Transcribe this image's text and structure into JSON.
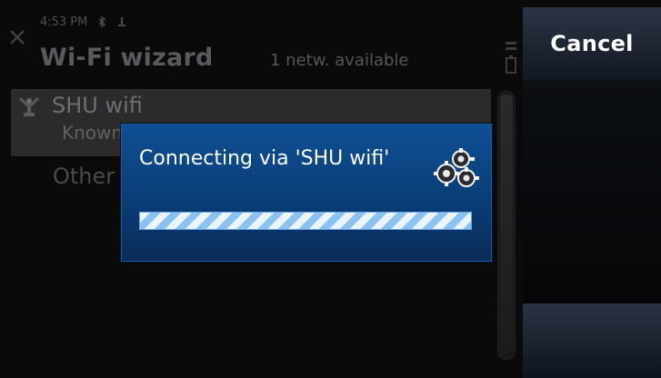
{
  "status_bar": {
    "time": "4:53 PM"
  },
  "header": {
    "title": "Wi-Fi wizard",
    "networks_available": "1 netw. available"
  },
  "list": {
    "items": [
      {
        "name": "SHU wifi",
        "status": "Known"
      },
      {
        "name": "Other"
      }
    ]
  },
  "softkeys": {
    "top_label": "Cancel"
  },
  "dialog": {
    "message": "Connecting via 'SHU wifi'",
    "progress": 1.0
  },
  "colors": {
    "dialog_blue": "#0a3f7a",
    "progress_light": "#eaf5ff",
    "progress_dark": "#8cc2f2"
  }
}
